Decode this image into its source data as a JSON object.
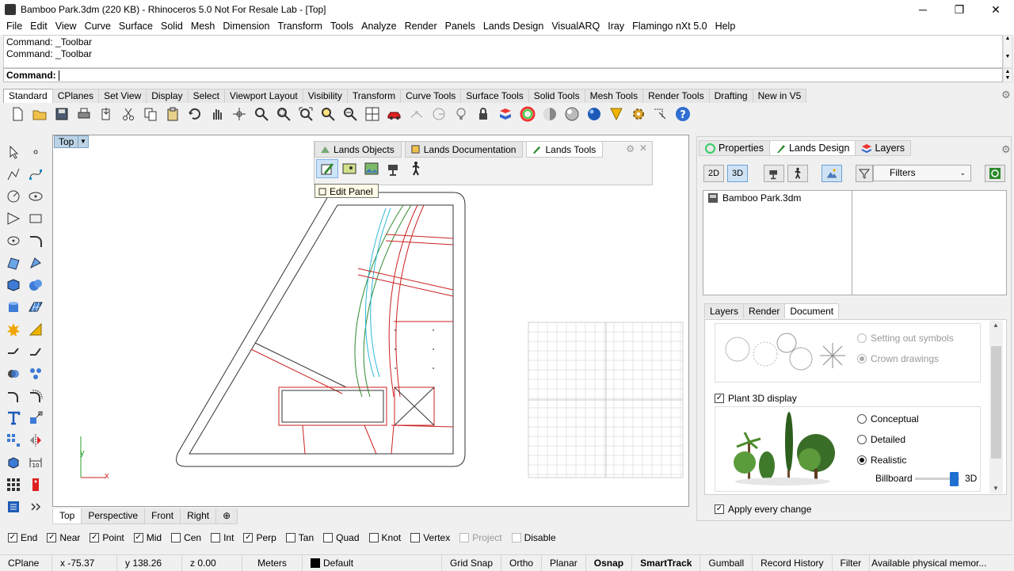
{
  "window": {
    "title": "Bamboo Park.3dm (220 KB) - Rhinoceros 5.0 Not For Resale Lab - [Top]",
    "minimize": "─",
    "restore": "❐",
    "close": "✕"
  },
  "menu": [
    "File",
    "Edit",
    "View",
    "Curve",
    "Surface",
    "Solid",
    "Mesh",
    "Dimension",
    "Transform",
    "Tools",
    "Analyze",
    "Render",
    "Panels",
    "Lands Design",
    "VisualARQ",
    "Iray",
    "Flamingo nXt 5.0",
    "Help"
  ],
  "command": {
    "history": [
      "Command: _Toolbar",
      "Command: _Toolbar"
    ],
    "prompt": "Command:"
  },
  "toolbar_tabs": [
    "Standard",
    "CPlanes",
    "Set View",
    "Display",
    "Select",
    "Viewport Layout",
    "Visibility",
    "Transform",
    "Curve Tools",
    "Surface Tools",
    "Solid Tools",
    "Mesh Tools",
    "Render Tools",
    "Drafting",
    "New in V5"
  ],
  "toolbar_icons": [
    "new-icon",
    "open-icon",
    "save-icon",
    "print-icon",
    "import-icon",
    "cut-icon",
    "copy-icon",
    "paste-icon",
    "undo-icon",
    "pan-icon",
    "move-icon",
    "zoom-icon",
    "zoom-window-icon",
    "zoom-extents-icon",
    "zoom-selected-icon",
    "rotate-view-icon",
    "four-viewports-icon",
    "car-icon",
    "lock-grid-icon",
    "cplane-icon",
    "light-icon",
    "lock-icon",
    "layer-icon",
    "color-wheel-icon",
    "shade-icon",
    "rendered-icon",
    "sphere-icon",
    "render-icon",
    "settings-icon",
    "analyze-icon",
    "help-icon"
  ],
  "left_toolbar_icons": [
    "select-icon",
    "point-icon",
    "polyline-icon",
    "curve-icon",
    "circle-icon",
    "ellipse-icon",
    "polygon-icon",
    "rectangle-icon",
    "arc-icon",
    "fillet-curve-icon",
    "surface-icon",
    "revolve-icon",
    "box-icon",
    "sphere-solid-icon",
    "cylinder-icon",
    "mesh-icon",
    "explode-icon",
    "trim-icon",
    "split-icon",
    "join-icon",
    "boolean-icon",
    "cluster-icon",
    "blend-icon",
    "offset-icon",
    "text-icon",
    "scale-icon",
    "array-icon",
    "mirror-icon",
    "block-icon",
    "dimension-icon",
    "grid-icon",
    "tag-icon",
    "more-icon"
  ],
  "viewport": {
    "name": "Top",
    "tabs": [
      "Top",
      "Perspective",
      "Front",
      "Right"
    ],
    "axis_y": "y",
    "axis_x": "x"
  },
  "float_panel": {
    "tabs": [
      "Lands Objects",
      "Lands Documentation",
      "Lands Tools"
    ],
    "tool_icons": [
      "edit-panel-icon",
      "map-icon",
      "image-icon",
      "camera-icon",
      "walk-icon"
    ],
    "tooltip": "Edit Panel"
  },
  "right_panel": {
    "tabs": [
      "Properties",
      "Lands Design",
      "Layers"
    ],
    "btn_2d": "2D",
    "btn_3d": "3D",
    "filter": "Filters",
    "tree_item": "Bamboo Park.3dm",
    "sub_tabs": [
      "Layers",
      "Render",
      "Document"
    ],
    "plan_options": [
      "Setting out symbols",
      "Crown drawings"
    ],
    "plant3d_label": "Plant 3D display",
    "plant3d_options": [
      "Conceptual",
      "Detailed",
      "Realistic"
    ],
    "billboard_label": "Billboard",
    "billboard_value": "3D",
    "apply_label": "Apply every change"
  },
  "osnaps": [
    {
      "label": "End",
      "checked": true
    },
    {
      "label": "Near",
      "checked": true
    },
    {
      "label": "Point",
      "checked": true
    },
    {
      "label": "Mid",
      "checked": true
    },
    {
      "label": "Cen",
      "checked": false
    },
    {
      "label": "Int",
      "checked": false
    },
    {
      "label": "Perp",
      "checked": true
    },
    {
      "label": "Tan",
      "checked": false
    },
    {
      "label": "Quad",
      "checked": false
    },
    {
      "label": "Knot",
      "checked": false
    },
    {
      "label": "Vertex",
      "checked": false
    },
    {
      "label": "Project",
      "checked": false
    },
    {
      "label": "Disable",
      "checked": false
    }
  ],
  "status": {
    "cplane": "CPlane",
    "x": "x -75.37",
    "y": "y 138.26",
    "z": "z 0.00",
    "units": "Meters",
    "layer": "Default",
    "toggles": [
      "Grid Snap",
      "Ortho",
      "Planar",
      "Osnap",
      "SmartTrack",
      "Gumball",
      "Record History",
      "Filter"
    ],
    "message": "Available physical memor..."
  }
}
